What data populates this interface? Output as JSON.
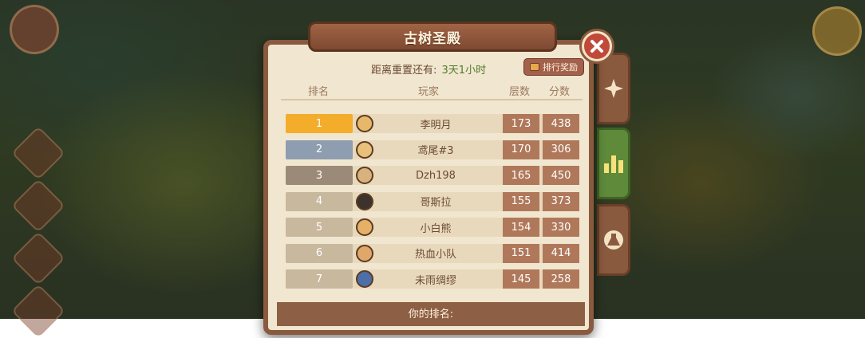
{
  "title": "古树圣殿",
  "reset": {
    "label": "距离重置还有:",
    "value": "3天1小时"
  },
  "reward_button": "排行奖励",
  "headers": {
    "rank": "排名",
    "player": "玩家",
    "layers": "层数",
    "score": "分数"
  },
  "rows": [
    {
      "rank": "1",
      "name": "李明月",
      "layers": "173",
      "score": "438",
      "rank_color": "#f3ad2b",
      "avatar_color": "#e7b86a"
    },
    {
      "rank": "2",
      "name": "鸢尾#3",
      "layers": "170",
      "score": "306",
      "rank_color": "#8e9db0",
      "avatar_color": "#e9c07a"
    },
    {
      "rank": "3",
      "name": "Dzh198",
      "layers": "165",
      "score": "450",
      "rank_color": "#9b8a78",
      "avatar_color": "#d7b27c"
    },
    {
      "rank": "4",
      "name": "哥斯拉",
      "layers": "155",
      "score": "373",
      "rank_color": "#c8b89d",
      "avatar_color": "#3b332c"
    },
    {
      "rank": "5",
      "name": "小白熊",
      "layers": "154",
      "score": "330",
      "rank_color": "#c8b89d",
      "avatar_color": "#e6b066"
    },
    {
      "rank": "6",
      "name": "热血小队",
      "layers": "151",
      "score": "414",
      "rank_color": "#c8b89d",
      "avatar_color": "#dfa86a"
    },
    {
      "rank": "7",
      "name": "未雨绸缪",
      "layers": "145",
      "score": "258",
      "rank_color": "#c8b89d",
      "avatar_color": "#4d6fa8"
    }
  ],
  "your_rank_label": "你的排名:",
  "colors": {
    "panel_bg": "#f1e6cf",
    "panel_border": "#8a5a3e",
    "cell_brown": "#b0785a",
    "active_tab": "#5e8a3a"
  },
  "tabs": [
    {
      "icon": "compass-star-icon",
      "active": false
    },
    {
      "icon": "podium-icon",
      "active": true
    },
    {
      "icon": "flask-icon",
      "active": false
    }
  ]
}
